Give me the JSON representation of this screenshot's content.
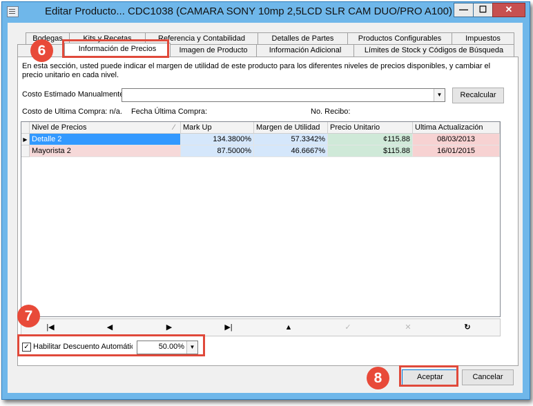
{
  "window": {
    "title": "Editar Producto... CDC1038 (CAMARA SONY 10mp 2,5LCD SLR CAM DUO/PRO A100)",
    "controls": {
      "minimize": "—",
      "maximize": "☐",
      "close": "✕"
    }
  },
  "tabs_row1": [
    "Bodegas",
    "Kits y Recetas",
    "Referencia y Contabilidad",
    "Detalles de Partes",
    "Productos Configurables",
    "Impuestos"
  ],
  "tabs_row2": [
    "G",
    "Información de Precios",
    "Imagen de Producto",
    "Información Adicional",
    "Límites de Stock y Códigos de Búsqueda"
  ],
  "active_tab": "Información de Precios",
  "panel": {
    "description": "En esta sección, usted puede indicar el margen de utilidad de este producto para los diferentes niveles de precios disponibles, y cambiar el precio unitario en cada nivel.",
    "costo_label": "Costo Estimado Manualmente:",
    "costo_value": "",
    "recalcular_label": "Recalcular",
    "ultima_compra_label": "Costo de Ultima Compra: n/a.",
    "fecha_label": "Fecha Última Compra:",
    "recibo_label": "No. Recibo:"
  },
  "grid": {
    "columns": [
      "Nivel de Precios",
      "Mark Up",
      "Margen de Utilidad",
      "Precio Unitario",
      "Ultima Actualización"
    ],
    "rows": [
      {
        "nivel": "Detalle 2",
        "markup": "134.3800%",
        "margen": "57.3342%",
        "precio": "¢115.88",
        "fecha": "08/03/2013"
      },
      {
        "nivel": "Mayorista 2",
        "markup": "87.5000%",
        "margen": "46.6667%",
        "precio": "$115.88",
        "fecha": "16/01/2015"
      }
    ]
  },
  "navigator": {
    "first": "|◀",
    "prev": "◀",
    "next": "▶",
    "last": "▶|",
    "insert": "▲",
    "post": "✓",
    "cancel": "✕",
    "refresh": "↻"
  },
  "discount": {
    "label": "Habilitar Descuento Automático",
    "checked": true,
    "check_glyph": "✓",
    "value": "50.00%"
  },
  "buttons": {
    "aceptar": "Aceptar",
    "cancelar": "Cancelar"
  },
  "annotations": {
    "step6": "6",
    "step7": "7",
    "step8": "8"
  },
  "colors": {
    "selection": "#3399ff",
    "markup_bg": "#d5e7fb",
    "precio_bg": "#cfe9d8",
    "fecha_bg": "#f7d2d2",
    "row2_bg": "#f6d9d9",
    "callout": "#e0493a"
  },
  "icons": {
    "dropdown": "chevron-down-icon",
    "row_pointer": "row-pointer-icon"
  }
}
